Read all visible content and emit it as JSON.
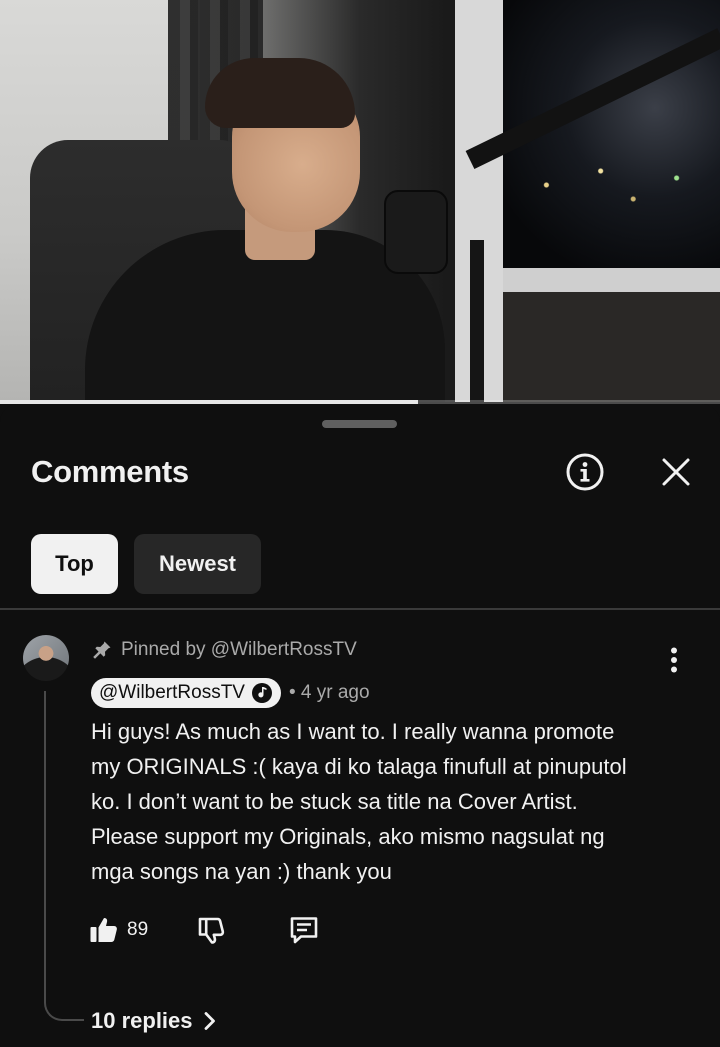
{
  "video": {
    "progress_fraction": 0.58
  },
  "sheet": {
    "title": "Comments",
    "sort_tabs": [
      {
        "label": "Top",
        "selected": true
      },
      {
        "label": "Newest",
        "selected": false
      }
    ]
  },
  "comment": {
    "pinned_label": "Pinned by @WilbertRossTV",
    "author": "@WilbertRossTV",
    "age": "• 4 yr ago",
    "text": "Hi guys! As much as I want to. I really wanna promote\nmy ORIGINALS :( kaya di ko talaga finufull at pinuputol\nko. I don’t want to be stuck sa title na Cover Artist.\nPlease support my Originals, ako mismo nagsulat ng\nmga songs na yan :) thank you",
    "likes": "89",
    "replies_label": "10 replies"
  },
  "icons": {
    "info": "info-icon",
    "close": "close-icon",
    "pin": "pin-icon",
    "verified": "music-note-verified-icon",
    "more": "more-vertical-icon",
    "like": "thumbs-up-icon",
    "dislike": "thumbs-down-icon",
    "reply": "reply-comment-icon",
    "chevron": "chevron-right-icon"
  },
  "colors": {
    "background": "#0f0f0f",
    "chip_selected": "#f1f1f1",
    "chip_unselected": "#272727",
    "secondary_text": "#aaaaaa"
  }
}
